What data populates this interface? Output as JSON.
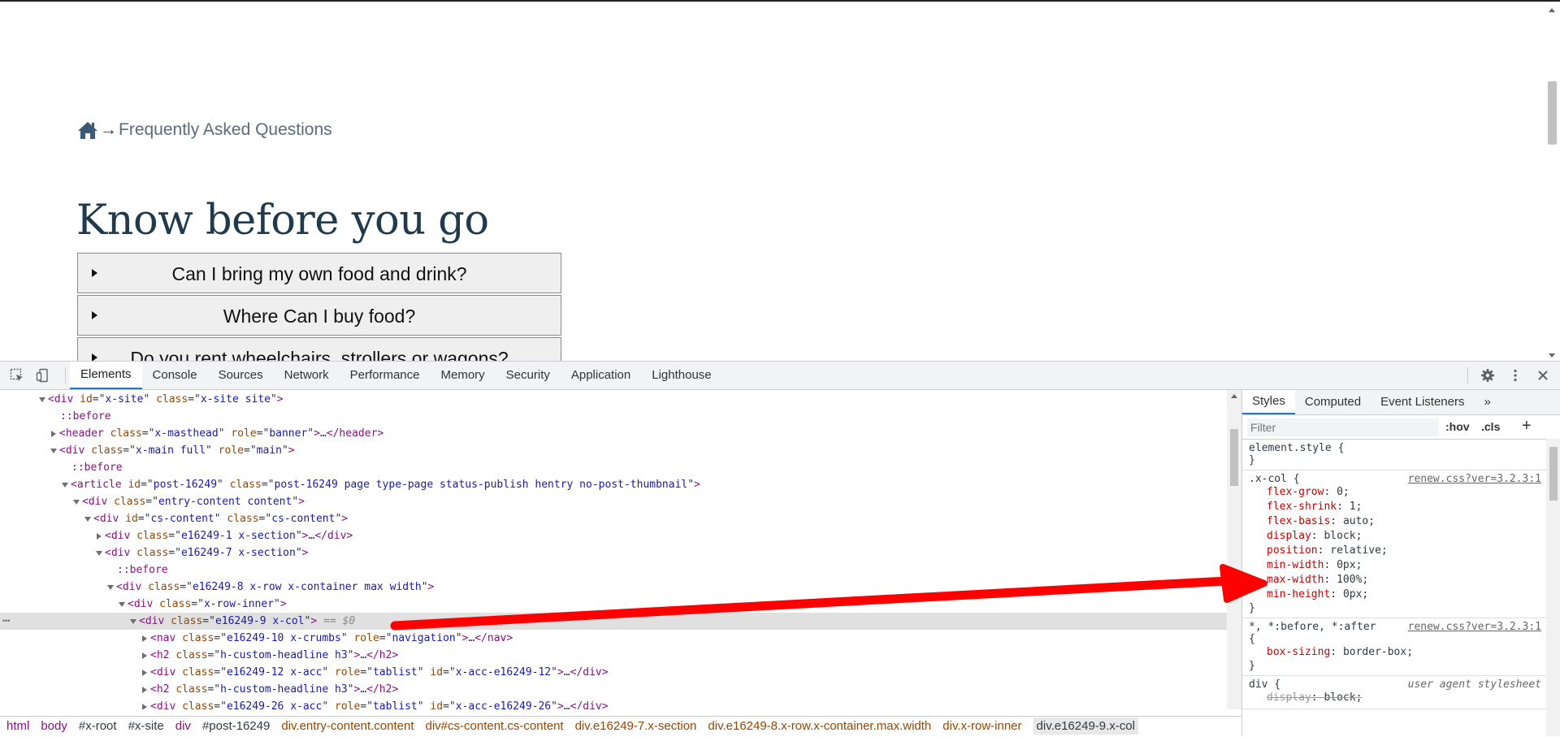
{
  "page": {
    "breadcrumb": {
      "arrow": "→",
      "current": "Frequently Asked Questions"
    },
    "heading": "Know before you go",
    "faq": [
      {
        "question": "Can I bring my own food and drink?"
      },
      {
        "question": "Where Can I buy food?"
      },
      {
        "question": "Do you rent wheelchairs, strollers or wagons?"
      }
    ]
  },
  "devtools": {
    "tabs": [
      "Elements",
      "Console",
      "Sources",
      "Network",
      "Performance",
      "Memory",
      "Security",
      "Application",
      "Lighthouse"
    ],
    "active_tab": "Elements",
    "dom_lines": [
      {
        "indent": 0,
        "tw": "open",
        "tag": "div",
        "attrs": [
          [
            "id",
            "x-site"
          ],
          [
            "class",
            "x-site site"
          ]
        ],
        "tail": ">"
      },
      {
        "indent": 1,
        "tw": "none",
        "pseudo": "::before"
      },
      {
        "indent": 1,
        "tw": "closed",
        "tag": "header",
        "attrs": [
          [
            "class",
            "x-masthead"
          ],
          [
            "role",
            "banner"
          ]
        ],
        "tail": ">…</header>"
      },
      {
        "indent": 1,
        "tw": "open",
        "tag": "div",
        "attrs": [
          [
            "class",
            "x-main full"
          ],
          [
            "role",
            "main"
          ]
        ],
        "tail": ">"
      },
      {
        "indent": 2,
        "tw": "none",
        "pseudo": "::before"
      },
      {
        "indent": 2,
        "tw": "open",
        "tag": "article",
        "attrs": [
          [
            "id",
            "post-16249"
          ],
          [
            "class",
            "post-16249 page type-page status-publish hentry no-post-thumbnail"
          ]
        ],
        "tail": ">"
      },
      {
        "indent": 3,
        "tw": "open",
        "tag": "div",
        "attrs": [
          [
            "class",
            "entry-content content"
          ]
        ],
        "tail": ">"
      },
      {
        "indent": 4,
        "tw": "open",
        "tag": "div",
        "attrs": [
          [
            "id",
            "cs-content"
          ],
          [
            "class",
            "cs-content"
          ]
        ],
        "tail": ">"
      },
      {
        "indent": 5,
        "tw": "closed",
        "tag": "div",
        "attrs": [
          [
            "class",
            "e16249-1 x-section"
          ]
        ],
        "tail": ">…</div>"
      },
      {
        "indent": 5,
        "tw": "open",
        "tag": "div",
        "attrs": [
          [
            "class",
            "e16249-7 x-section"
          ]
        ],
        "tail": ">"
      },
      {
        "indent": 6,
        "tw": "none",
        "pseudo": "::before"
      },
      {
        "indent": 6,
        "tw": "open",
        "tag": "div",
        "attrs": [
          [
            "class",
            "e16249-8 x-row x-container max width"
          ]
        ],
        "tail": ">"
      },
      {
        "indent": 7,
        "tw": "open",
        "tag": "div",
        "attrs": [
          [
            "class",
            "x-row-inner"
          ]
        ],
        "tail": ">"
      },
      {
        "indent": 8,
        "tw": "open",
        "tag": "div",
        "attrs": [
          [
            "class",
            "e16249-9 x-col"
          ]
        ],
        "tail": ">",
        "selected": true,
        "eq": "== $0"
      },
      {
        "indent": 9,
        "tw": "closed",
        "tag": "nav",
        "attrs": [
          [
            "class",
            "e16249-10 x-crumbs"
          ],
          [
            "role",
            "navigation"
          ]
        ],
        "tail": ">…</nav>"
      },
      {
        "indent": 9,
        "tw": "closed",
        "tag": "h2",
        "attrs": [
          [
            "class",
            "h-custom-headline h3"
          ]
        ],
        "tail": ">…</h2>"
      },
      {
        "indent": 9,
        "tw": "closed",
        "tag": "div",
        "attrs": [
          [
            "class",
            "e16249-12 x-acc"
          ],
          [
            "role",
            "tablist"
          ],
          [
            "id",
            "x-acc-e16249-12"
          ]
        ],
        "tail": ">…</div>"
      },
      {
        "indent": 9,
        "tw": "closed",
        "tag": "h2",
        "attrs": [
          [
            "class",
            "h-custom-headline h3"
          ]
        ],
        "tail": ">…</h2>"
      },
      {
        "indent": 9,
        "tw": "closed",
        "tag": "div",
        "attrs": [
          [
            "class",
            "e16249-26 x-acc"
          ],
          [
            "role",
            "tablist"
          ],
          [
            "id",
            "x-acc-e16249-26"
          ]
        ],
        "tail": ">…</div>"
      }
    ],
    "breadcrumb_path": [
      {
        "t": "html",
        "k": "tag"
      },
      {
        "t": "body",
        "k": "tag"
      },
      {
        "t": "#x-root",
        "k": "id"
      },
      {
        "t": "#x-site",
        "k": "id"
      },
      {
        "t": "div",
        "k": "tag"
      },
      {
        "t": "#post-16249",
        "k": "id"
      },
      {
        "t": "div.entry-content.content",
        "k": "cls"
      },
      {
        "t": "div#cs-content.cs-content",
        "k": "cls"
      },
      {
        "t": "div.e16249-7.x-section",
        "k": "cls"
      },
      {
        "t": "div.e16249-8.x-row.x-container.max.width",
        "k": "cls"
      },
      {
        "t": "div.x-row-inner",
        "k": "cls"
      },
      {
        "t": "div.e16249-9.x-col",
        "k": "sel"
      }
    ],
    "styles_tabs": [
      "Styles",
      "Computed",
      "Event Listeners",
      "»"
    ],
    "styles_active": "Styles",
    "filter_placeholder": "Filter",
    "hov": ":hov",
    "cls": ".cls",
    "rules": [
      {
        "selector": "element.style {",
        "source": "",
        "decls": []
      },
      {
        "selector": ".x-col {",
        "source": "renew.css?ver=3.2.3:1",
        "decls": [
          [
            "flex-grow",
            "0"
          ],
          [
            "flex-shrink",
            "1"
          ],
          [
            "flex-basis",
            "auto"
          ],
          [
            "display",
            "block"
          ],
          [
            "position",
            "relative"
          ],
          [
            "min-width",
            "0px"
          ],
          [
            "max-width",
            "100%"
          ],
          [
            "min-height",
            "0px"
          ]
        ]
      },
      {
        "selector": "*, *:before, *:after",
        "source": "renew.css?ver=3.2.3:1",
        "open": "{",
        "decls": [
          [
            "box-sizing",
            "border-box"
          ]
        ]
      },
      {
        "selector": "div {",
        "source": "user agent stylesheet",
        "ua": true,
        "decls": [
          [
            "display",
            "block"
          ]
        ],
        "struck": true
      }
    ]
  },
  "colors": {
    "arrow": "#ff0000",
    "accent": "#1a73e8",
    "heading": "#1e3a4c"
  }
}
